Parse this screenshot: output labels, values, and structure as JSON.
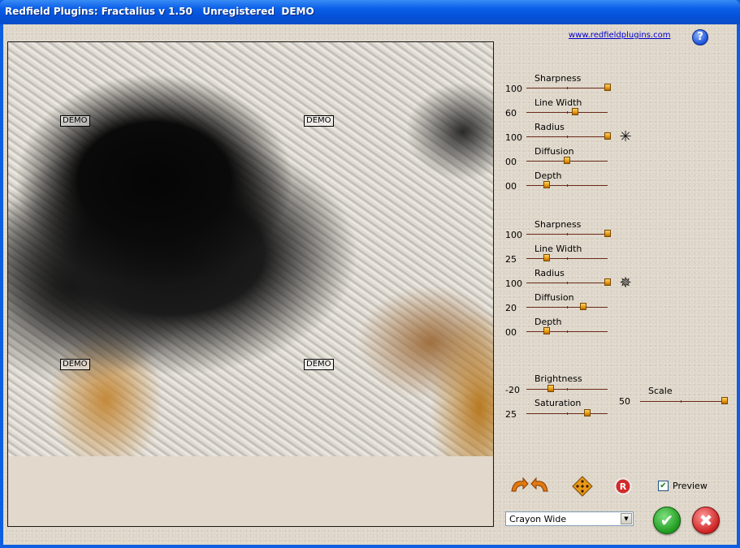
{
  "window": {
    "title": "Redfield Plugins: Fractalius v 1.50   Unregistered  DEMO"
  },
  "header": {
    "website_link": "www.redfieldplugins.com",
    "help_icon": "help-icon"
  },
  "preview": {
    "watermark": "DEMO"
  },
  "group1": {
    "sliders": [
      {
        "label": "Sharpness",
        "value": "100",
        "position": 1.0
      },
      {
        "label": "Line Width",
        "value": "60",
        "position": 0.6
      },
      {
        "label": "Radius",
        "value": "100",
        "position": 1.0
      },
      {
        "label": "Diffusion",
        "value": "00",
        "position": 0.5
      },
      {
        "label": "Depth",
        "value": "00",
        "position": 0.25
      }
    ],
    "reset_icon": "star-burst-icon"
  },
  "group2": {
    "sliders": [
      {
        "label": "Sharpness",
        "value": "100",
        "position": 1.0
      },
      {
        "label": "Line Width",
        "value": "25",
        "position": 0.25
      },
      {
        "label": "Radius",
        "value": "100",
        "position": 1.0
      },
      {
        "label": "Diffusion",
        "value": "20",
        "position": 0.7
      },
      {
        "label": "Depth",
        "value": "00",
        "position": 0.25
      }
    ],
    "reset_icon": "star-burst-icon"
  },
  "adjust": {
    "brightness": {
      "label": "Brightness",
      "value": "-20",
      "position": 0.3
    },
    "saturation": {
      "label": "Saturation",
      "value": "25",
      "position": 0.75
    },
    "scale": {
      "label": "Scale",
      "value": "50",
      "position": 1.0
    }
  },
  "toolbar": {
    "undo_redo_icon": "undo-redo-arrows-icon",
    "dice_icon": "dice-icon",
    "reset_icon": "reset-r-icon",
    "preview_label": "Preview",
    "preview_checked": true
  },
  "preset": {
    "selected": "Crayon Wide"
  },
  "actions": {
    "ok_icon": "checkmark-icon",
    "cancel_icon": "close-icon"
  },
  "colors": {
    "titlebar": "#0a5fe8",
    "client_bg": "#ded6c9",
    "slider_thumb": "#e59a0d",
    "slider_track": "#6a2a1a",
    "ok": "#2aa52a",
    "cancel": "#d23030"
  }
}
